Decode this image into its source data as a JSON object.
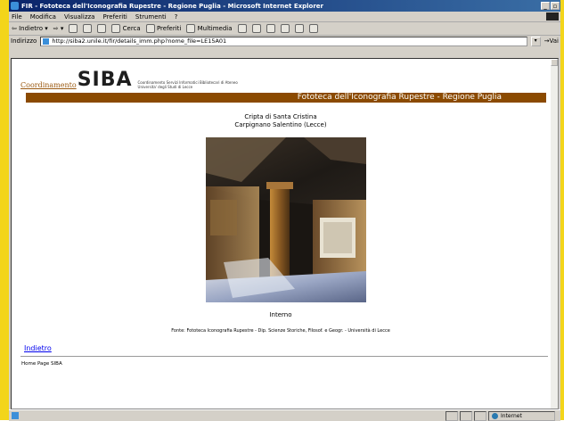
{
  "window": {
    "title": "FIR - Fototeca dell'Iconografia Rupestre - Regione Puglia - Microsoft Internet Explorer"
  },
  "menu": [
    "File",
    "Modifica",
    "Visualizza",
    "Preferiti",
    "Strumenti",
    "?"
  ],
  "toolbar": {
    "back": "Indietro",
    "search": "Cerca",
    "favorites": "Preferiti",
    "multimedia": "Multimedia"
  },
  "address": {
    "label": "Indirizzo",
    "url": "http://siba2.unile.it/fir/details_imm.php?nome_file=LE15A01",
    "go": "Vai"
  },
  "page": {
    "logo_coord": "Coordinamento",
    "logo_siba": "SIBA",
    "logo_line1": "Coordinamento Servizi Informatici Bibliotecari di Ateneo",
    "logo_line2": "Universita' degli Studi di Lecce",
    "banner": "Fototeca dell'Iconografia Rupestre - Regione Puglia",
    "site_name": "Cripta di Santa Cristina",
    "location": "Carpignano Salentino (Lecce)",
    "caption": "Interno",
    "source": "Fonte: Fototeca Iconografia Rupestre - Dip. Scienze Storiche, Filosof. e Geogr. - Università di Lecce",
    "back_link": "Indietro",
    "home_link": "Home Page SIBA"
  },
  "status": {
    "zone": "Internet"
  },
  "colors": {
    "banner": "#8b4a00",
    "desktop": "#f3d51a",
    "titlebar": "#0a246a",
    "link": "#0000ee"
  }
}
